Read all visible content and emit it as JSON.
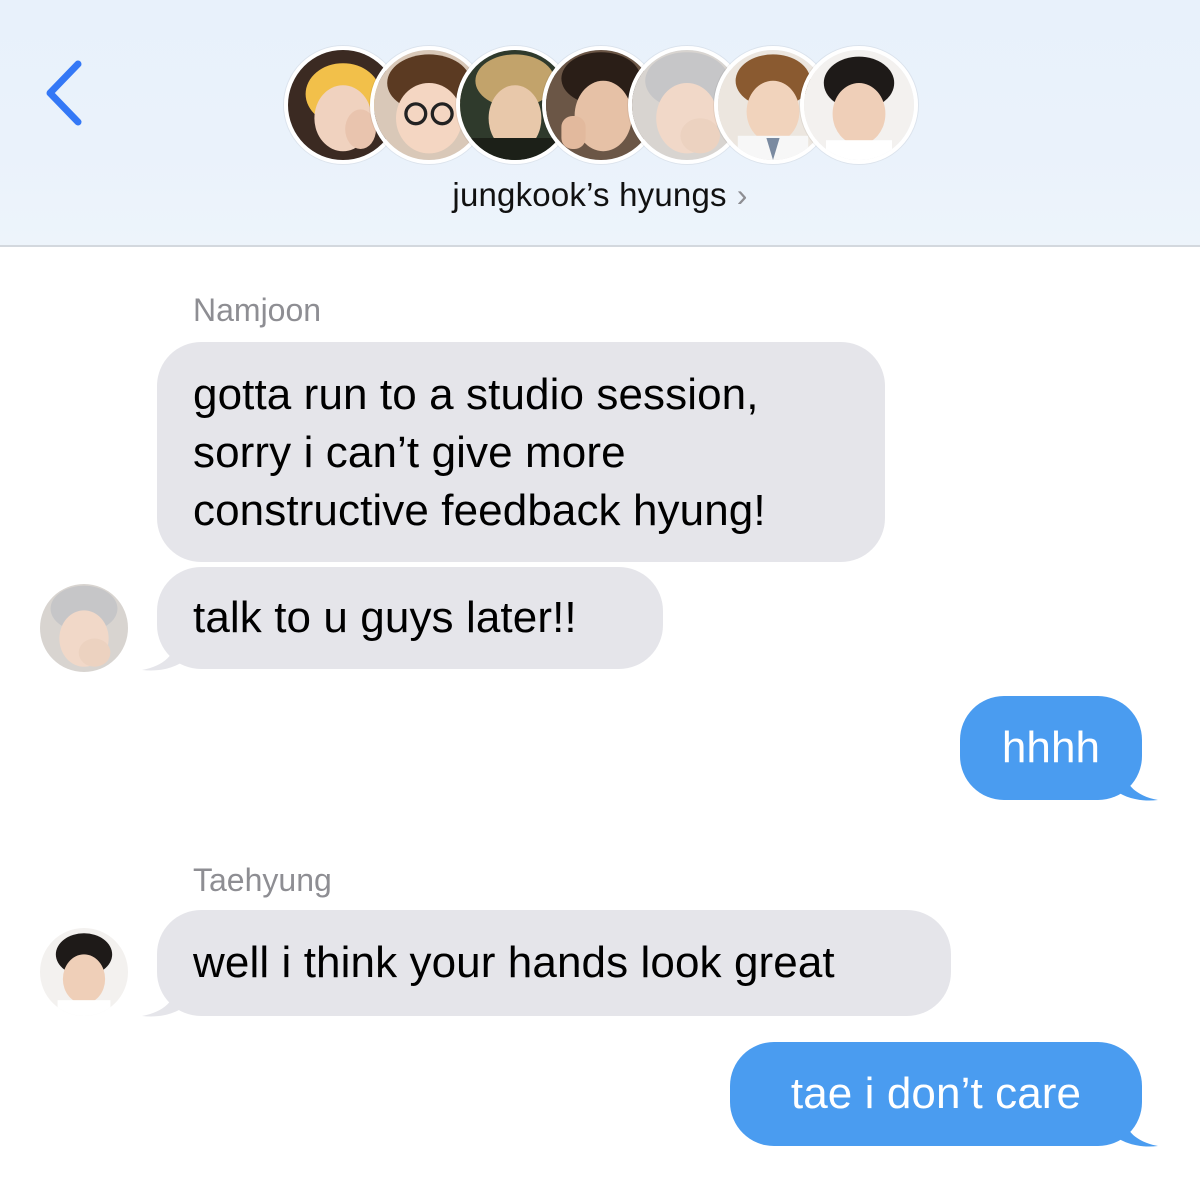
{
  "header": {
    "group_name": "jungkook’s hyungs",
    "chevron": "›",
    "back_icon": "chevron-left-icon",
    "accent_color": "#3478f6"
  },
  "messages": [
    {
      "sender": "Namjoon"
    },
    {
      "text": "gotta run to a studio session,\nsorry i can’t give more\nconstructive feedback hyung!",
      "direction": "received"
    },
    {
      "text": "talk to u guys later!!",
      "direction": "received"
    },
    {
      "text": "hhhh",
      "direction": "sent"
    },
    {
      "sender": "Taehyung"
    },
    {
      "text": "well i think your hands look great",
      "direction": "received"
    },
    {
      "text": "tae i don’t care",
      "direction": "sent"
    }
  ],
  "colors": {
    "received_bubble": "#e5e5ea",
    "sent_bubble": "#4a9cf0",
    "header_bg": "#e9f1fb",
    "sender_label": "#8e8e93"
  }
}
